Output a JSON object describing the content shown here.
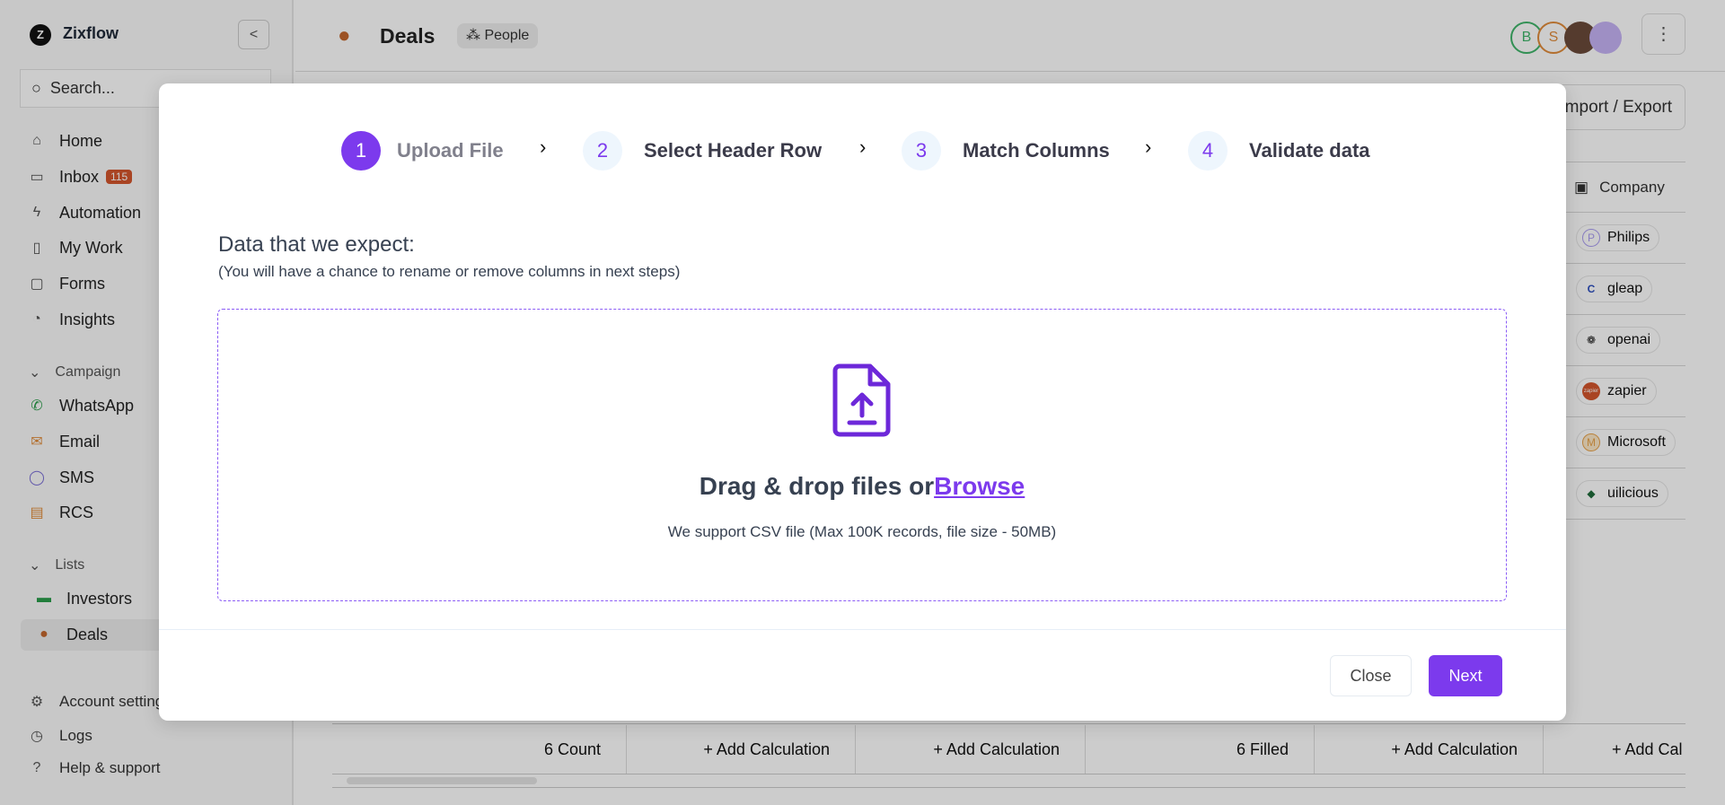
{
  "sidebar": {
    "brand": "Zixflow",
    "search_placeholder": "Search...",
    "nav": [
      {
        "label": "Home",
        "icon": "home-icon"
      },
      {
        "label": "Inbox",
        "badge": "115",
        "icon": "inbox-icon"
      },
      {
        "label": "Automation",
        "icon": "lightning-icon"
      },
      {
        "label": "My Work",
        "icon": "board-icon"
      },
      {
        "label": "Forms",
        "icon": "document-icon"
      },
      {
        "label": "Insights",
        "icon": "pie-chart-icon"
      }
    ],
    "campaign_label": "Campaign",
    "campaign": [
      {
        "label": "WhatsApp"
      },
      {
        "label": "Email"
      },
      {
        "label": "SMS"
      },
      {
        "label": "RCS"
      }
    ],
    "lists_label": "Lists",
    "lists": [
      {
        "label": "Investors"
      },
      {
        "label": "Deals"
      }
    ],
    "footer": [
      {
        "label": "Account settings"
      },
      {
        "label": "Logs"
      },
      {
        "label": "Help & support"
      }
    ]
  },
  "header": {
    "title": "Deals",
    "view_chip": "People",
    "avatars": [
      "B",
      "S"
    ],
    "import_export": "Import / Export"
  },
  "table": {
    "column": "Company",
    "rows": [
      {
        "name": "Philips",
        "logo": "P"
      },
      {
        "name": "gleap",
        "logo": "C"
      },
      {
        "name": "openai",
        "logo": "❁"
      },
      {
        "name": "zapier",
        "logo": "zapier"
      },
      {
        "name": "Microsoft",
        "logo": "M"
      },
      {
        "name": "uilicious",
        "logo": "◆"
      }
    ],
    "footer": [
      "6  Count",
      "+ Add Calculation",
      "+ Add Calculation",
      "6 Filled",
      "+ Add Calculation",
      "+ Add Cal"
    ]
  },
  "modal": {
    "steps": [
      {
        "num": "1",
        "label": "Upload File"
      },
      {
        "num": "2",
        "label": "Select Header Row"
      },
      {
        "num": "3",
        "label": "Match Columns"
      },
      {
        "num": "4",
        "label": "Validate data"
      }
    ],
    "heading": "Data that we expect:",
    "subheading": "(You will have a chance to rename or remove columns in next steps)",
    "drop_text": "Drag & drop files or",
    "browse": "Browse",
    "support_text": "We support CSV file (Max 100K records, file size - 50MB)",
    "close": "Close",
    "next": "Next"
  },
  "colors": {
    "accent": "#7c3aed"
  }
}
